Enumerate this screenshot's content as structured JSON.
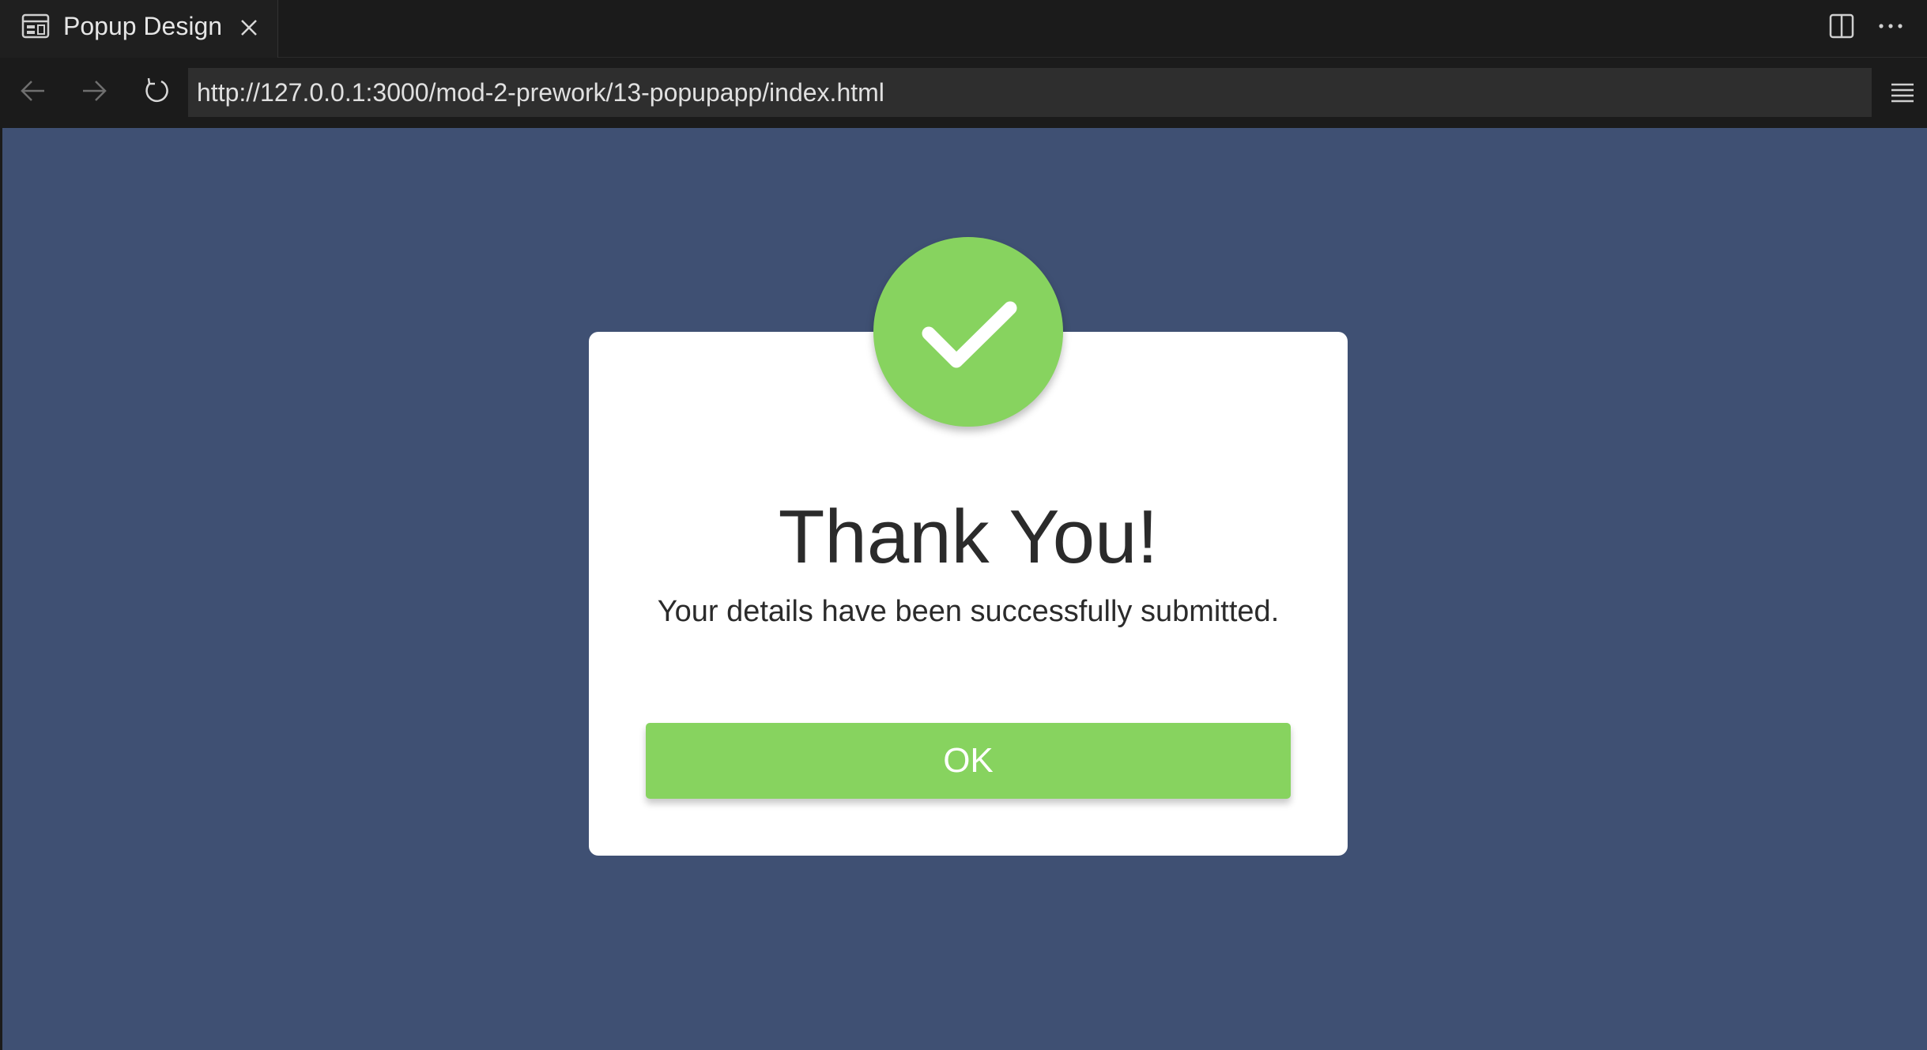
{
  "tab": {
    "title": "Popup Design",
    "icon": "preview-icon"
  },
  "address_bar": {
    "url": "http://127.0.0.1:3000/mod-2-prework/13-popupapp/index.html"
  },
  "popup": {
    "title": "Thank You!",
    "message": "Your details have been successfully submitted.",
    "ok_label": "OK",
    "icon": "checkmark-icon"
  },
  "colors": {
    "page_background": "#3f5073",
    "accent_green": "#87d35f",
    "chrome_background": "#1b1b1b",
    "text_dark": "#2b2b2b"
  }
}
